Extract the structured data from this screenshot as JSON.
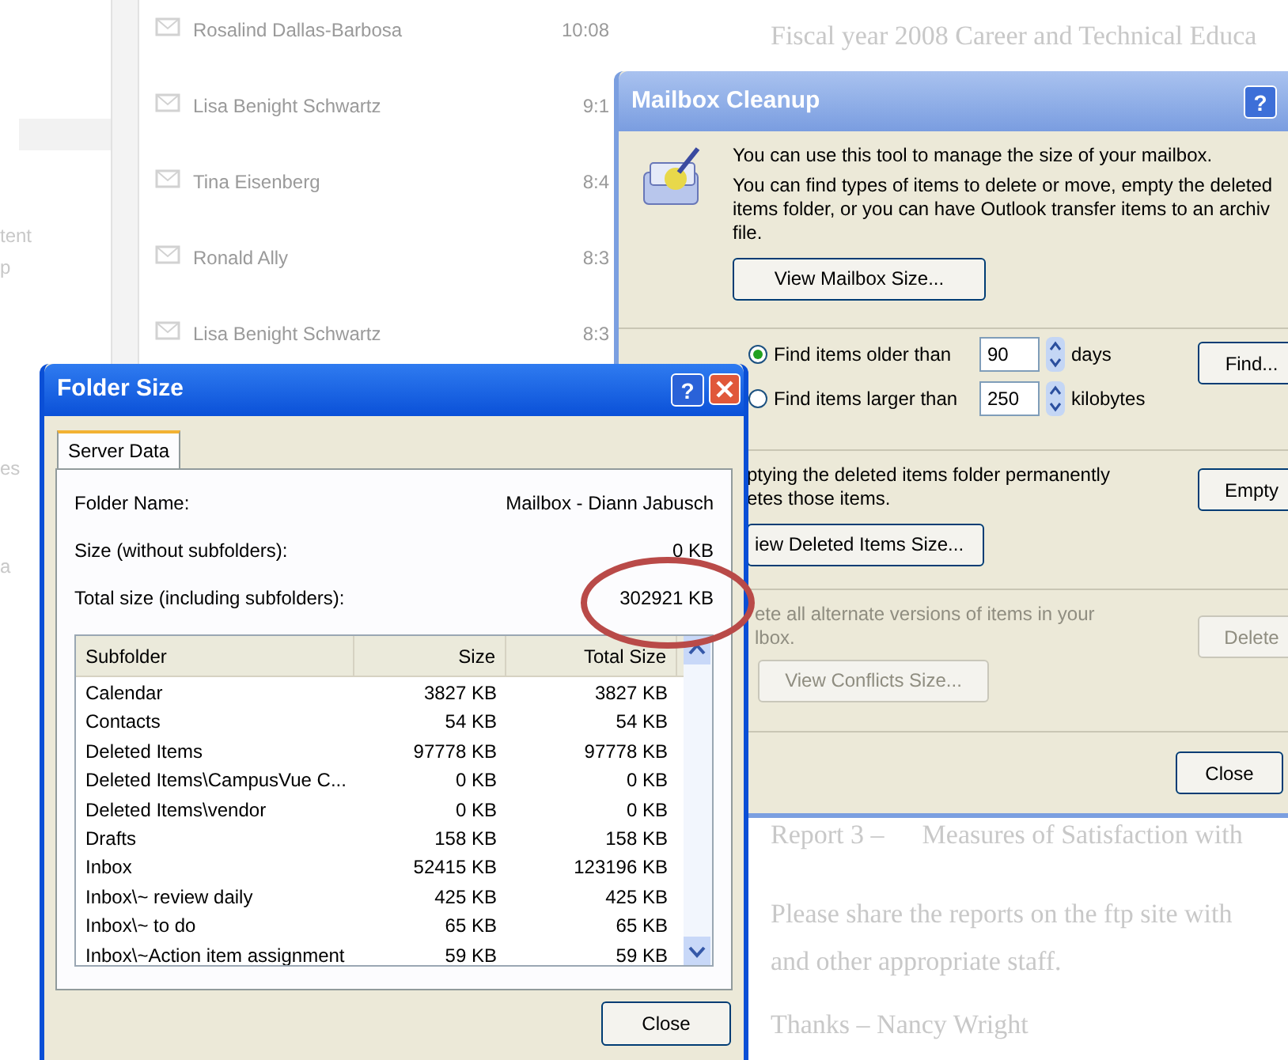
{
  "background": {
    "left_pane_fragments": [
      "tent",
      "p",
      "es",
      "a"
    ],
    "mail_list": [
      {
        "sender": "Rosalind Dallas-Barbosa",
        "time": "10:08"
      },
      {
        "sender": "Lisa Benight Schwartz",
        "time": "9:1"
      },
      {
        "sender": "Tina Eisenberg",
        "time": "8:4"
      },
      {
        "sender": "Ronald Ally",
        "time": "8:3"
      },
      {
        "sender": "Lisa Benight Schwartz",
        "time": "8:3"
      }
    ],
    "document": {
      "title_line": "Fiscal year 2008 Career and Technical Educa",
      "report_label": "Report 3 –",
      "report_title": "Measures of Satisfaction with",
      "paragraph_lines": [
        "Please share the reports on the ftp site with",
        "and other appropriate staff."
      ],
      "signoff": "Thanks – Nancy Wright"
    }
  },
  "mailbox_cleanup": {
    "title": "Mailbox Cleanup",
    "help": "?",
    "intro": "You can use this tool to manage the size of your mailbox.",
    "description_lines": [
      "You can find types of items to delete or move, empty the deleted",
      "items folder, or you can have Outlook transfer items to an archiv",
      "file."
    ],
    "view_size_button": "View Mailbox Size...",
    "find_rows": [
      {
        "label": "Find items older than",
        "value": "90",
        "unit": "days",
        "selected": true
      },
      {
        "label": "Find items larger than",
        "value": "250",
        "unit": "kilobytes",
        "selected": false
      }
    ],
    "find_button": "Find...",
    "empty_lines": [
      "ptying the deleted items folder permanently",
      "etes those items."
    ],
    "view_deleted_button": "iew Deleted Items Size...",
    "empty_button": "Empty",
    "conflicts_lines": [
      "ete all alternate versions of items in your",
      "lbox."
    ],
    "conflicts_disabled": true,
    "view_conflicts_button": "View Conflicts Size...",
    "delete_button": "Delete",
    "close_button": "Close"
  },
  "folder_size": {
    "title": "Folder Size",
    "help": "?",
    "tabs": [
      {
        "label": "Server Data",
        "selected": true
      }
    ],
    "fields": [
      {
        "label": "Folder Name:",
        "value": "Mailbox - Diann Jabusch"
      },
      {
        "label": "Size (without subfolders):",
        "value": "0 KB"
      },
      {
        "label": "Total size (including subfolders):",
        "value": "302921 KB"
      }
    ],
    "table": {
      "columns": [
        "Subfolder",
        "Size",
        "Total Size"
      ],
      "rows": [
        [
          "Calendar",
          "3827 KB",
          "3827 KB"
        ],
        [
          "Contacts",
          "54 KB",
          "54 KB"
        ],
        [
          "Deleted Items",
          "97778 KB",
          "97778 KB"
        ],
        [
          "Deleted Items\\CampusVue C...",
          "0 KB",
          "0 KB"
        ],
        [
          "Deleted Items\\vendor",
          "0 KB",
          "0 KB"
        ],
        [
          "Drafts",
          "158 KB",
          "158 KB"
        ],
        [
          "Inbox",
          "52415 KB",
          "123196 KB"
        ],
        [
          "Inbox\\~ review daily",
          "425 KB",
          "425 KB"
        ],
        [
          "Inbox\\~ to do",
          "65 KB",
          "65 KB"
        ],
        [
          "Inbox\\~Action item assignment",
          "59 KB",
          "59 KB"
        ]
      ]
    },
    "close_button": "Close"
  }
}
